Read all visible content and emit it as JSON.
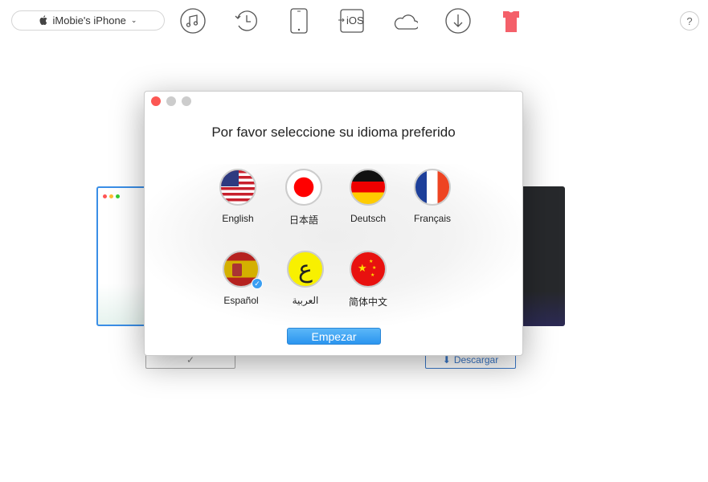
{
  "toolbar": {
    "device_label": "iMobie's iPhone",
    "icons": [
      "apple-icon",
      "music-icon",
      "history-icon",
      "phone-icon",
      "ios-transfer-icon",
      "cloud-icon",
      "download-icon",
      "tshirt-icon"
    ],
    "ios_text": "iOS",
    "help": "?"
  },
  "background": {
    "download_label": "Descargar",
    "check": "✓"
  },
  "dialog": {
    "title": "Por favor seleccione su idioma preferido",
    "languages": [
      {
        "label": "English",
        "flag": "us"
      },
      {
        "label": "日本語",
        "flag": "jp"
      },
      {
        "label": "Deutsch",
        "flag": "de"
      },
      {
        "label": "Français",
        "flag": "fr"
      },
      {
        "label": "Español",
        "flag": "es",
        "selected": true
      },
      {
        "label": "العربية",
        "flag": "ar",
        "glyph": "ع"
      },
      {
        "label": "简体中文",
        "flag": "cn"
      }
    ],
    "start_label": "Empezar"
  },
  "colors": {
    "accent": "#2b95ef",
    "close": "#fc5753",
    "tshirt": "#f4606a"
  }
}
